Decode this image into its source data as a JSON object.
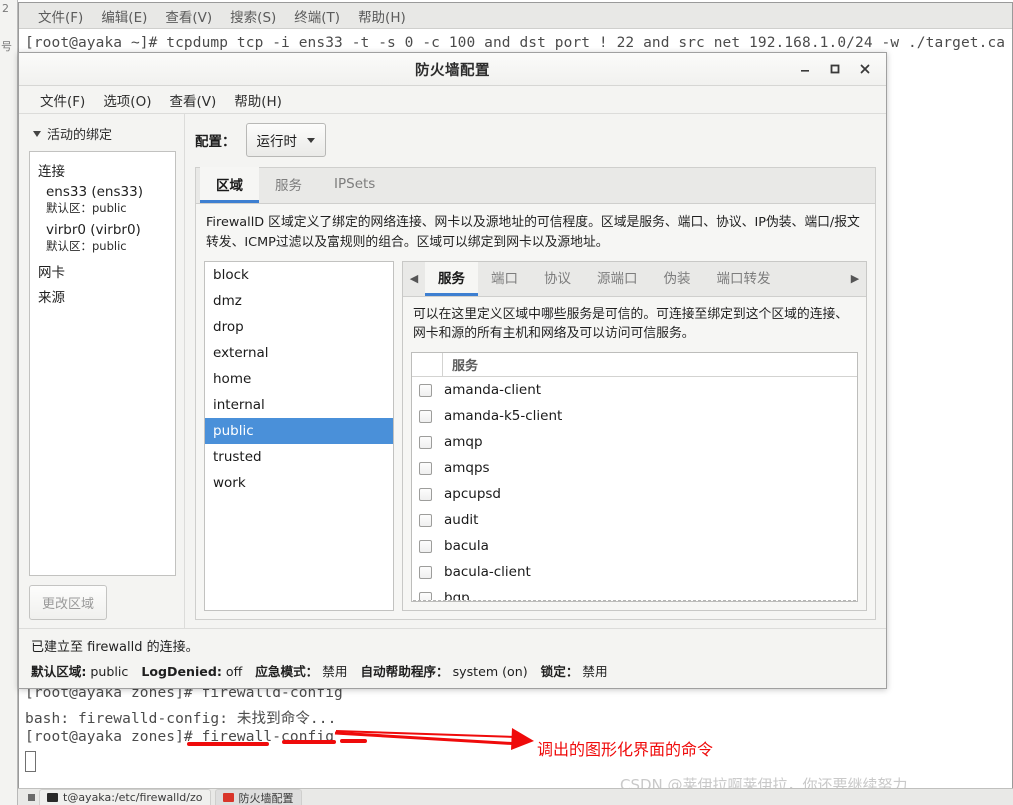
{
  "terminal": {
    "menu": [
      "文件(F)",
      "编辑(E)",
      "查看(V)",
      "搜索(S)",
      "终端(T)",
      "帮助(H)"
    ],
    "lines": [
      "[root@ayaka ~]# tcpdump tcp -i ens33 -t -s 0 -c 100 and dst port ! 22 and src net 192.168.1.0/24 -w ./target.ca",
      "[root@ayaka zones]# firewalld-config",
      "bash: firewalld-config: 未找到命令...",
      "[root@ayaka zones]# firewall-config"
    ],
    "sliver_label": "号"
  },
  "firewall": {
    "title": "防火墙配置",
    "window_buttons": [
      "minimize-icon",
      "maximize-icon",
      "close-icon"
    ],
    "menu": [
      "文件(F)",
      "选项(O)",
      "查看(V)",
      "帮助(H)"
    ],
    "left": {
      "bindings_header": "活动的绑定",
      "group_title": "连接",
      "connections": [
        {
          "name": "ens33 (ens33)",
          "sub_label": "默认区",
          "sub_value": "public"
        },
        {
          "name": "virbr0 (virbr0)",
          "sub_label": "默认区",
          "sub_value": "public"
        }
      ],
      "other_groups": [
        "网卡",
        "来源"
      ],
      "change_zone_button": "更改区域"
    },
    "config": {
      "label": "配置：",
      "selected": "运行时"
    },
    "top_tabs": [
      {
        "label": "区域",
        "active": true
      },
      {
        "label": "服务",
        "active": false
      },
      {
        "label": "IPSets",
        "active": false
      }
    ],
    "zone_description": "FirewallD 区域定义了绑定的网络连接、网卡以及源地址的可信程度。区域是服务、端口、协议、IP伪装、端口/报文转发、ICMP过滤以及富规则的组合。区域可以绑定到网卡以及源地址。",
    "zones": [
      "block",
      "dmz",
      "drop",
      "external",
      "home",
      "internal",
      "public",
      "trusted",
      "work"
    ],
    "selected_zone": "public",
    "inner_tabs": [
      {
        "label": "服务",
        "active": true
      },
      {
        "label": "端口",
        "active": false
      },
      {
        "label": "协议",
        "active": false
      },
      {
        "label": "源端口",
        "active": false
      },
      {
        "label": "伪装",
        "active": false
      },
      {
        "label": "端口转发",
        "active": false
      }
    ],
    "inner_tab_scroll_left": "◀",
    "inner_tab_scroll_right": "▶",
    "service_description": "可以在这里定义区域中哪些服务是可信的。可连接至绑定到这个区域的连接、网卡和源的所有主机和网络及可以访问可信服务。",
    "services_column_header": "服务",
    "services": [
      {
        "name": "amanda-client",
        "checked": false
      },
      {
        "name": "amanda-k5-client",
        "checked": false
      },
      {
        "name": "amqp",
        "checked": false
      },
      {
        "name": "amqps",
        "checked": false
      },
      {
        "name": "apcupsd",
        "checked": false
      },
      {
        "name": "audit",
        "checked": false
      },
      {
        "name": "bacula",
        "checked": false
      },
      {
        "name": "bacula-client",
        "checked": false
      },
      {
        "name": "bgp",
        "checked": false
      }
    ],
    "status": {
      "connection_line": "已建立至 firewalld 的连接。",
      "items": [
        {
          "key": "默认区域:",
          "value": "public"
        },
        {
          "key": "LogDenied:",
          "value": "off"
        },
        {
          "key": "应急模式：",
          "value": "禁用"
        },
        {
          "key": "自动帮助程序：",
          "value": "system (on)"
        },
        {
          "key": "锁定：",
          "value": "禁用"
        }
      ]
    }
  },
  "annotation": {
    "text": "调出的图形化界面的命令",
    "color": "#ef0b0b"
  },
  "watermark": "CSDN @莱伊拉啊莱伊拉，你还要继续努力",
  "taskbar": {
    "show_desktop": "show-desktop-icon",
    "buttons": [
      {
        "label": "t@ayaka:/etc/firewalld/zo",
        "icon": "terminal-icon",
        "active": false
      },
      {
        "label": "防火墙配置",
        "icon": "firewall-icon",
        "active": true
      }
    ]
  }
}
